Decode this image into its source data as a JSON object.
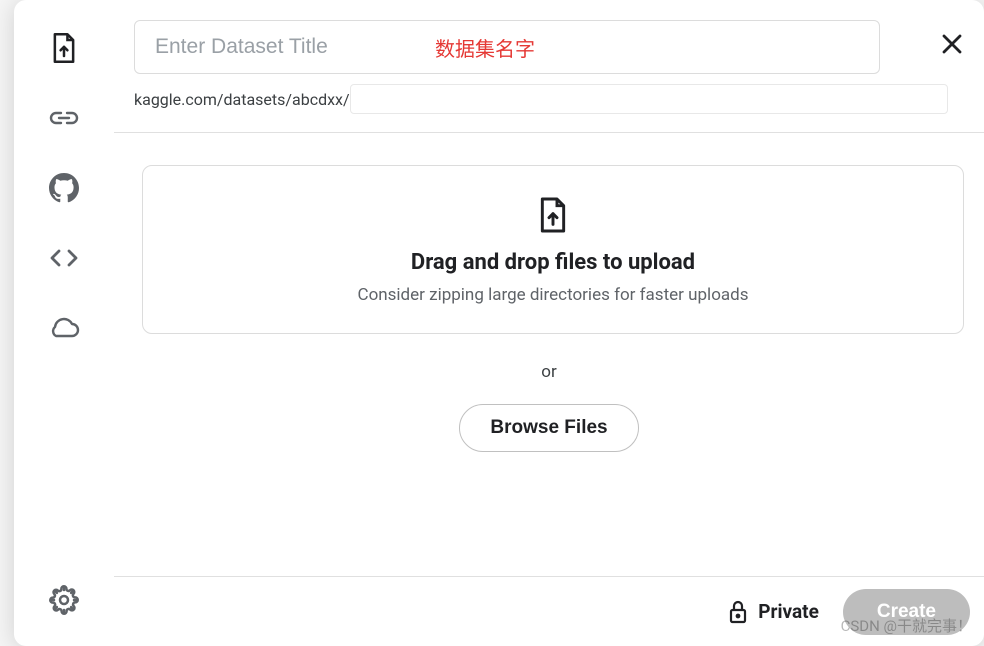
{
  "title_input": {
    "placeholder": "Enter Dataset Title",
    "value": ""
  },
  "annotation": "数据集名字",
  "url": {
    "prefix": "kaggle.com/datasets/abcdxx/",
    "slug": ""
  },
  "upload": {
    "title": "Drag and drop files to upload",
    "subtitle": "Consider zipping large directories for faster uploads",
    "or": "or",
    "browse": "Browse Files"
  },
  "footer": {
    "private": "Private",
    "create": "Create"
  },
  "watermark": "CSDN @干就完事！",
  "sidebar_icons": {
    "upload": "upload-file-icon",
    "link": "link-icon",
    "github": "github-icon",
    "code": "code-icon",
    "cloud": "cloud-icon",
    "settings": "gear-icon"
  }
}
